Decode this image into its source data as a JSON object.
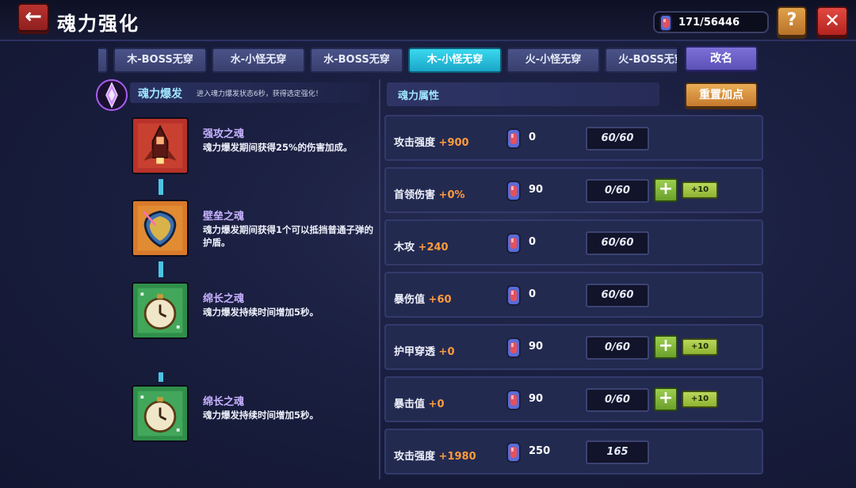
{
  "header": {
    "title": "魂力强化",
    "currency_value": "171/56446"
  },
  "tabs": [
    {
      "label": ""
    },
    {
      "label": "木-BOSS无穿"
    },
    {
      "label": "水-小怪无穿"
    },
    {
      "label": "水-BOSS无穿"
    },
    {
      "label": "木-小怪无穿",
      "active": true
    },
    {
      "label": "火-小怪无穿"
    },
    {
      "label": "火-BOSS无穿"
    }
  ],
  "rename_label": "改名",
  "burst": {
    "title": "魂力爆发",
    "description": "进入魂力爆发状态6秒，获得选定强化！"
  },
  "skills": [
    {
      "name": "强攻之魂",
      "description": "魂力爆发期间获得25%的伤害加成。",
      "icon": "rocket-icon"
    },
    {
      "name": "壁垒之魂",
      "description": "魂力爆发期间获得1个可以抵挡普通子弹的护盾。",
      "icon": "shield-icon"
    },
    {
      "name": "绵长之魂",
      "description": "魂力爆发持续时间增加5秒。",
      "icon": "clock-icon"
    },
    {
      "name": "绵长之魂",
      "description": "魂力爆发持续时间增加5秒。",
      "icon": "clock-icon"
    }
  ],
  "attributes_title": "魂力属性",
  "reset_label": "重置加点",
  "attributes": [
    {
      "name": "攻击强度",
      "bonus": "+900",
      "cost": "0",
      "level": "60/60",
      "upgradable": false
    },
    {
      "name": "首领伤害",
      "bonus": "+0%",
      "cost": "90",
      "level": "0/60",
      "upgradable": true
    },
    {
      "name": "木攻",
      "bonus": "+240",
      "cost": "0",
      "level": "60/60",
      "upgradable": false
    },
    {
      "name": "暴伤值",
      "bonus": "+60",
      "cost": "0",
      "level": "60/60",
      "upgradable": false
    },
    {
      "name": "护甲穿透",
      "bonus": "+0",
      "cost": "90",
      "level": "0/60",
      "upgradable": true
    },
    {
      "name": "暴击值",
      "bonus": "+0",
      "cost": "90",
      "level": "0/60",
      "upgradable": true
    },
    {
      "name": "攻击强度",
      "bonus": "+1980",
      "cost": "250",
      "level": "165",
      "upgradable": false
    }
  ],
  "plus_label": "+",
  "plus10_label": "+10",
  "colors": {
    "accent_cyan": "#3ad8ef",
    "bonus_orange": "#ff9b3d",
    "skill_name": "#c7b1ff"
  }
}
